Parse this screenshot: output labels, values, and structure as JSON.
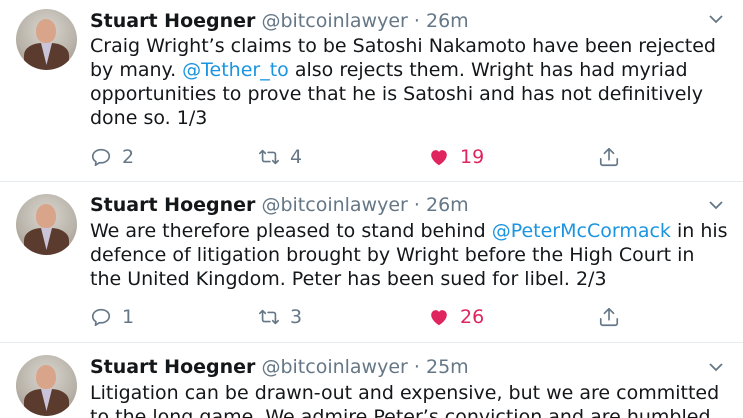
{
  "tweets": [
    {
      "name": "Stuart Hoegner",
      "handle": "@bitcoinlawyer",
      "sep": "·",
      "time": "26m",
      "text_segments": [
        {
          "t": "Craig Wright’s claims to be Satoshi Nakamoto have been rejected by many. ",
          "mention": false
        },
        {
          "t": "@Tether_to",
          "mention": true
        },
        {
          "t": " also rejects them. Wright has had myriad opportunities to prove that he is Satoshi and has not definitively done so. 1/3",
          "mention": false
        }
      ],
      "replies": "2",
      "retweets": "4",
      "likes": "19"
    },
    {
      "name": "Stuart Hoegner",
      "handle": "@bitcoinlawyer",
      "sep": "·",
      "time": "26m",
      "text_segments": [
        {
          "t": "We are therefore pleased to stand behind ",
          "mention": false
        },
        {
          "t": "@PeterMcCormack",
          "mention": true
        },
        {
          "t": " in his defence of litigation brought by Wright before the High Court in the United Kingdom. Peter has been sued for libel. 2/3",
          "mention": false
        }
      ],
      "replies": "1",
      "retweets": "3",
      "likes": "26"
    },
    {
      "name": "Stuart Hoegner",
      "handle": "@bitcoinlawyer",
      "sep": "·",
      "time": "25m",
      "text_segments": [
        {
          "t": "Litigation can be drawn-out and expensive, but we are committed to the long game. We admire Peter’s conviction and are humbled",
          "mention": false
        }
      ],
      "replies": "",
      "retweets": "",
      "likes": ""
    }
  ],
  "colors": {
    "mention": "#1b95e0",
    "like": "#e0245e",
    "muted": "#657786"
  },
  "icons": [
    "chevron-down-icon",
    "reply-icon",
    "retweet-icon",
    "heart-filled-icon",
    "share-icon"
  ]
}
